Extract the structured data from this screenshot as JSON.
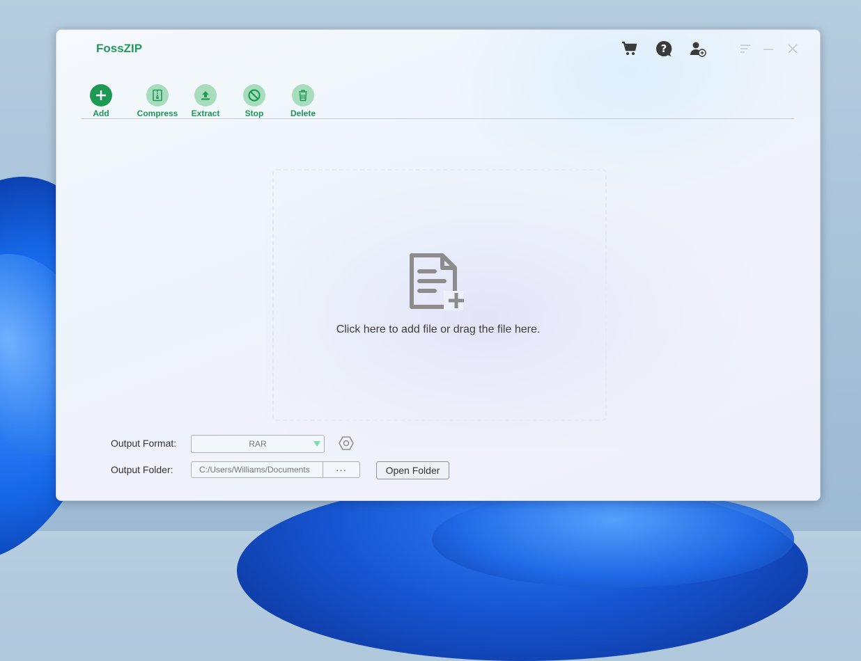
{
  "app": {
    "title": "FossZIP"
  },
  "topbar": {
    "icons": [
      "cart-icon",
      "help-icon",
      "account-icon"
    ],
    "window_controls": [
      "menu-icon",
      "minimize-icon",
      "close-icon"
    ]
  },
  "toolbar": {
    "add": "Add",
    "compress": "Compress",
    "extract": "Extract",
    "stop": "Stop",
    "delete": "Delete"
  },
  "dropzone": {
    "text": "Click here to add file or drag the file here."
  },
  "output": {
    "format_label": "Output Format:",
    "format_value": "RAR",
    "folder_label": "Output Folder:",
    "folder_path": "C:/Users/Williams/Documents",
    "browse_label": "···",
    "open_folder_label": "Open Folder"
  },
  "colors": {
    "accent": "#1c9a55",
    "accent_light": "#a7dcbd"
  }
}
